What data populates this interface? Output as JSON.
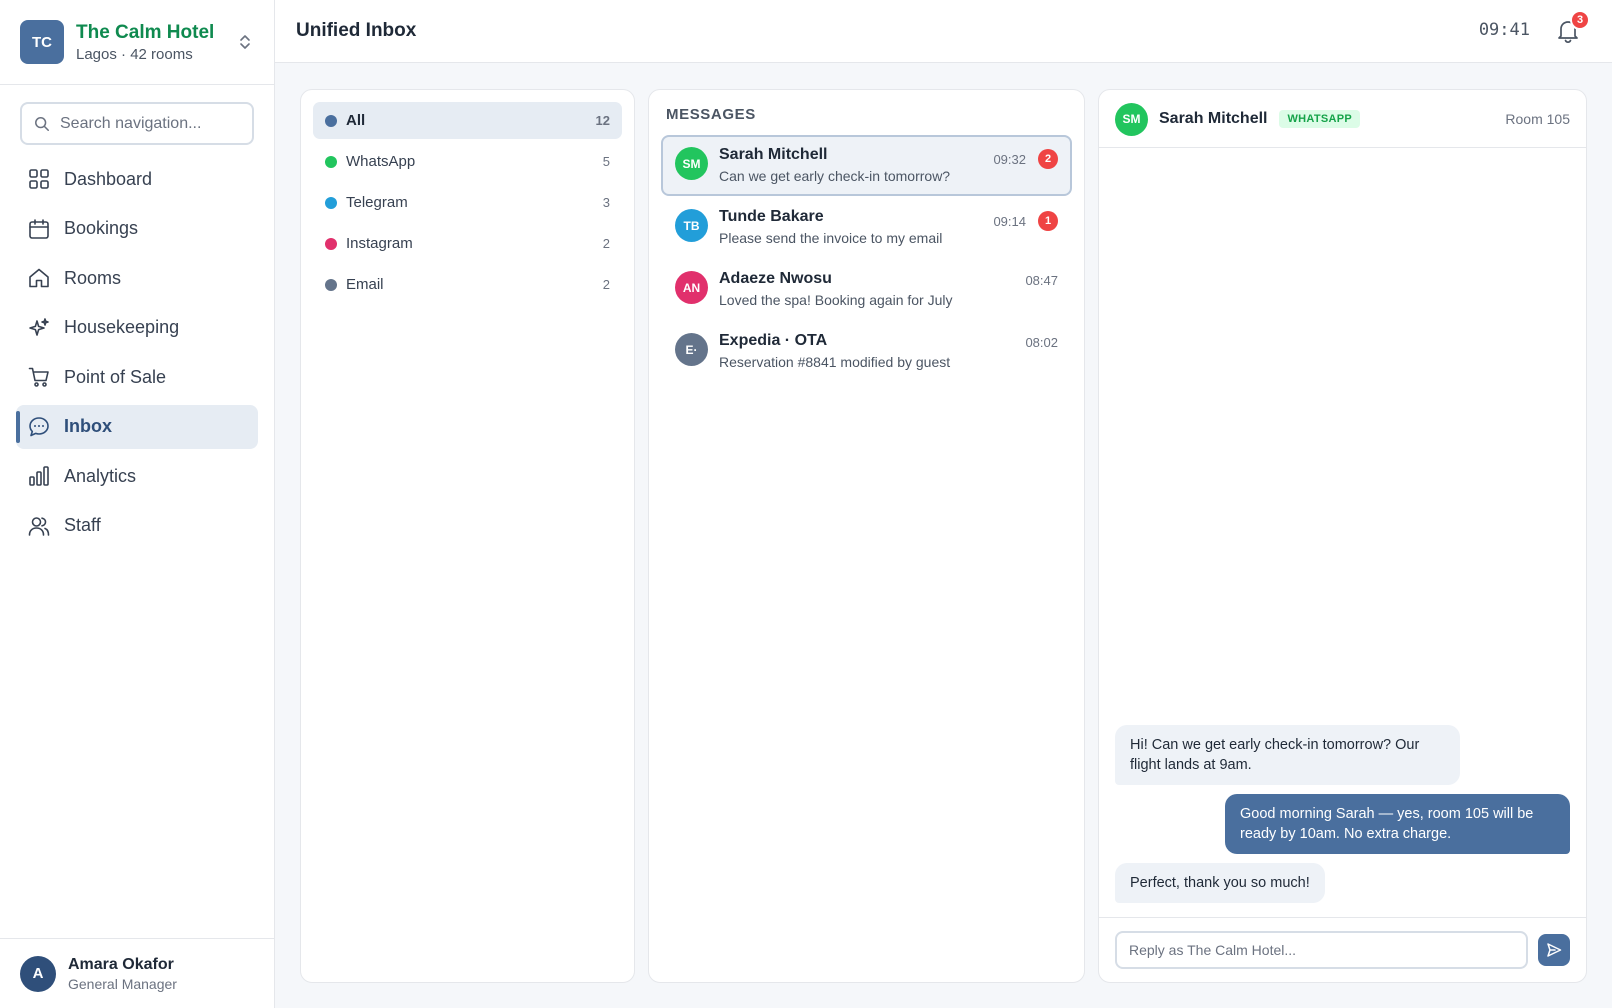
{
  "hotel": {
    "initials": "TC",
    "name": "The Calm Hotel",
    "subtitle": "Lagos · 42 rooms"
  },
  "nav_search": {
    "placeholder": "Search navigation..."
  },
  "nav": {
    "items": [
      {
        "label": "Dashboard",
        "icon": "grid-icon"
      },
      {
        "label": "Bookings",
        "icon": "calendar-icon"
      },
      {
        "label": "Rooms",
        "icon": "home-icon"
      },
      {
        "label": "Housekeeping",
        "icon": "sparkle-icon"
      },
      {
        "label": "Point of Sale",
        "icon": "cart-icon"
      },
      {
        "label": "Inbox",
        "icon": "chat-icon",
        "active": true
      },
      {
        "label": "Analytics",
        "icon": "bar-chart-icon"
      },
      {
        "label": "Staff",
        "icon": "users-icon"
      }
    ]
  },
  "user": {
    "initial": "A",
    "name": "Amara Okafor",
    "role": "General Manager"
  },
  "topbar": {
    "title": "Unified Inbox",
    "clock": "09:41",
    "notifications": "3"
  },
  "filters": [
    {
      "label": "All",
      "count": "12",
      "color": "#4a6f9e",
      "active": true
    },
    {
      "label": "WhatsApp",
      "count": "5",
      "color": "#22c55e"
    },
    {
      "label": "Telegram",
      "count": "3",
      "color": "#229ed9"
    },
    {
      "label": "Instagram",
      "count": "2",
      "color": "#e1306c"
    },
    {
      "label": "Email",
      "count": "2",
      "color": "#64748b"
    }
  ],
  "messages": {
    "title": "MESSAGES",
    "items": [
      {
        "initials": "SM",
        "name": "Sarah Mitchell",
        "preview": "Can we get early check-in tomorrow?",
        "time": "09:32",
        "unread": "2",
        "color": "#22c55e",
        "active": true
      },
      {
        "initials": "TB",
        "name": "Tunde Bakare",
        "preview": "Please send the invoice to my email",
        "time": "09:14",
        "unread": "1",
        "color": "#229ed9"
      },
      {
        "initials": "AN",
        "name": "Adaeze Nwosu",
        "preview": "Loved the spa! Booking again for July",
        "time": "08:47",
        "unread": "",
        "color": "#e1306c"
      },
      {
        "initials": "E·",
        "name": "Expedia · OTA",
        "preview": "Reservation #8841 modified by guest",
        "time": "08:02",
        "unread": "",
        "color": "#64748b"
      }
    ]
  },
  "chat": {
    "initials": "SM",
    "name": "Sarah Mitchell",
    "channel": "WHATSAPP",
    "room": "Room 105",
    "messages": [
      {
        "dir": "in",
        "text": "Hi! Can we get early check-in tomorrow? Our flight lands at 9am."
      },
      {
        "dir": "out",
        "text": "Good morning Sarah — yes, room 105 will be ready by 10am. No extra charge."
      },
      {
        "dir": "in",
        "text": "Perfect, thank you so much!"
      }
    ],
    "reply_placeholder": "Reply as The Calm Hotel..."
  }
}
